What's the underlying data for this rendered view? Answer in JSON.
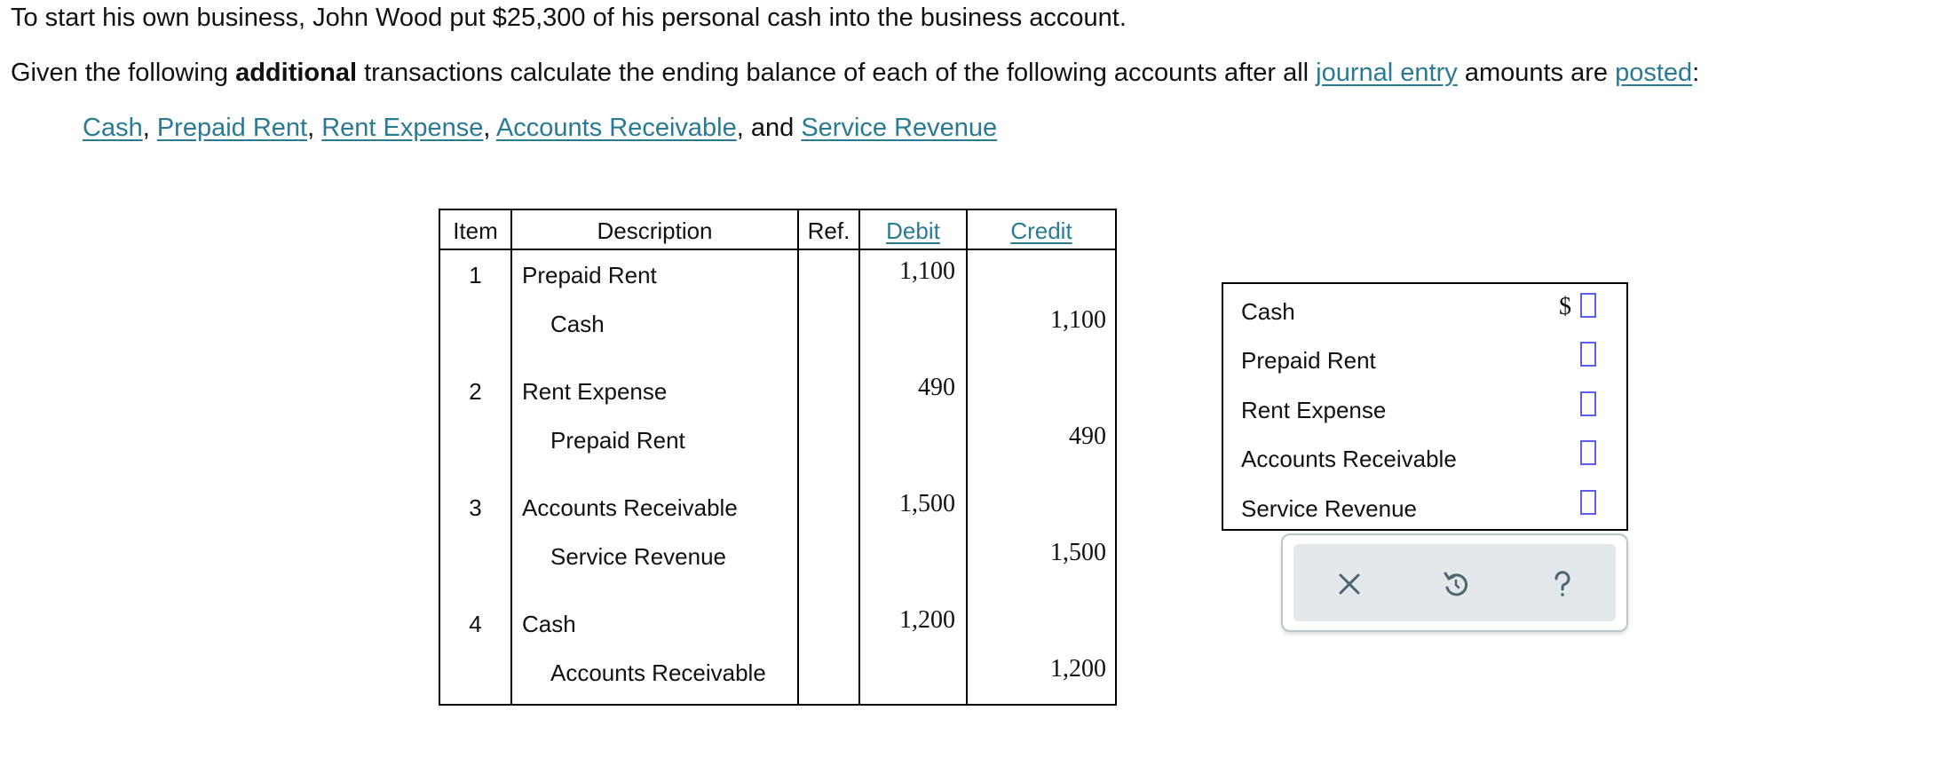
{
  "intro": {
    "line1": "To start his own business, John Wood put $25,300 of his personal cash into the business account.",
    "line2_a": "Given the following ",
    "line2_bold": "additional",
    "line2_b": " transactions calculate the ending balance of each of the following accounts after all ",
    "link_journal_entry": "journal entry",
    "line2_c": " amounts are ",
    "link_posted": "posted",
    "line2_d": ":",
    "accounts_links": [
      "Cash",
      "Prepaid Rent",
      "Rent Expense",
      "Accounts Receivable",
      "Service Revenue"
    ],
    "sep_comma": ",",
    "sep_and": ", and"
  },
  "journal": {
    "headers": {
      "item": "Item",
      "description": "Description",
      "ref": "Ref.",
      "debit": "Debit",
      "credit": "Credit"
    },
    "entries": [
      {
        "item": "1",
        "debit_account": "Prepaid Rent",
        "credit_account": "Cash",
        "debit": "1,100",
        "credit": "1,100"
      },
      {
        "item": "2",
        "debit_account": "Rent Expense",
        "credit_account": "Prepaid Rent",
        "debit": "490",
        "credit": "490"
      },
      {
        "item": "3",
        "debit_account": "Accounts Receivable",
        "credit_account": "Service Revenue",
        "debit": "1,500",
        "credit": "1,500"
      },
      {
        "item": "4",
        "debit_account": "Cash",
        "credit_account": "Accounts Receivable",
        "debit": "1,200",
        "credit": "1,200"
      }
    ]
  },
  "answers": {
    "currency_symbol": "$",
    "rows": [
      {
        "label": "Cash",
        "value": ""
      },
      {
        "label": "Prepaid Rent",
        "value": ""
      },
      {
        "label": "Rent Expense",
        "value": ""
      },
      {
        "label": "Accounts Receivable",
        "value": ""
      },
      {
        "label": "Service Revenue",
        "value": ""
      }
    ]
  },
  "toolbar": {
    "icons": [
      "close-icon",
      "undo-icon",
      "help-icon"
    ]
  },
  "colors": {
    "link": "#2a7a93",
    "input_border": "#5b5ee8",
    "toolbar_bg": "#e3e8ea",
    "icon": "#4d6670"
  }
}
